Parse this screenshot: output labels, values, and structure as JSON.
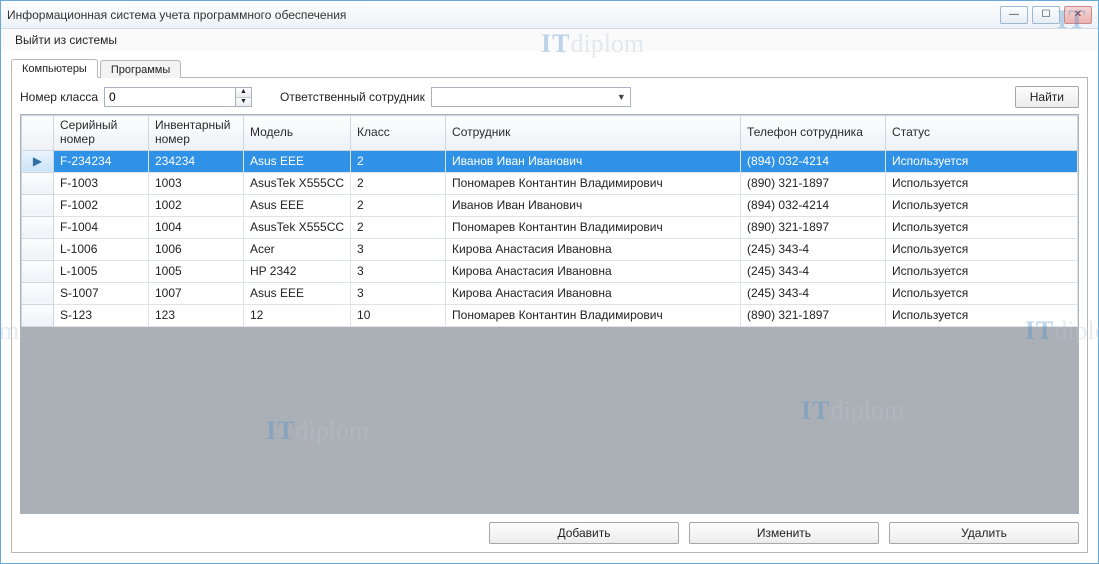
{
  "window": {
    "title": "Информационная система учета программного обеспечения"
  },
  "menu": {
    "logout": "Выйти из системы"
  },
  "tabs": {
    "computers": "Компьютеры",
    "programs": "Программы"
  },
  "filters": {
    "class_label": "Номер класса",
    "class_value": "0",
    "employee_label": "Ответственный сотрудник",
    "employee_value": "",
    "find_button": "Найти"
  },
  "grid": {
    "headers": {
      "serial": "Серийный номер",
      "inventory": "Инвентарный номер",
      "model": "Модель",
      "class": "Класс",
      "employee": "Сотрудник",
      "phone": "Телефон сотрудника",
      "status": "Статус"
    },
    "rows": [
      {
        "serial": "F-234234",
        "inventory": "234234",
        "model": "Asus EEE",
        "class": "2",
        "employee": "Иванов Иван Иванович",
        "phone": "(894) 032-4214",
        "status": "Используется",
        "selected": true
      },
      {
        "serial": "F-1003",
        "inventory": "1003",
        "model": "AsusTek X555CC",
        "class": "2",
        "employee": "Пономарев Контантин Владимирович",
        "phone": "(890) 321-1897",
        "status": "Используется"
      },
      {
        "serial": "F-1002",
        "inventory": "1002",
        "model": "Asus EEE",
        "class": "2",
        "employee": "Иванов Иван Иванович",
        "phone": "(894) 032-4214",
        "status": "Используется"
      },
      {
        "serial": "F-1004",
        "inventory": "1004",
        "model": "AsusTek X555CC",
        "class": "2",
        "employee": "Пономарев Контантин Владимирович",
        "phone": "(890) 321-1897",
        "status": "Используется"
      },
      {
        "serial": "L-1006",
        "inventory": "1006",
        "model": "Acer",
        "class": "3",
        "employee": "Кирова Анастасия Ивановна",
        "phone": "(245) 343-4",
        "status": "Используется"
      },
      {
        "serial": "L-1005",
        "inventory": "1005",
        "model": "HP 2342",
        "class": "3",
        "employee": "Кирова Анастасия Ивановна",
        "phone": "(245) 343-4",
        "status": "Используется"
      },
      {
        "serial": "S-1007",
        "inventory": "1007",
        "model": "Asus EEE",
        "class": "3",
        "employee": "Кирова Анастасия Ивановна",
        "phone": "(245) 343-4",
        "status": "Используется"
      },
      {
        "serial": "S-123",
        "inventory": "123",
        "model": "12",
        "class": "10",
        "employee": "Пономарев Контантин Владимирович",
        "phone": "(890) 321-1897",
        "status": "Используется"
      }
    ]
  },
  "actions": {
    "add": "Добавить",
    "edit": "Изменить",
    "delete": "Удалить"
  },
  "watermark": {
    "it": "IT",
    "rest": "diplom"
  }
}
